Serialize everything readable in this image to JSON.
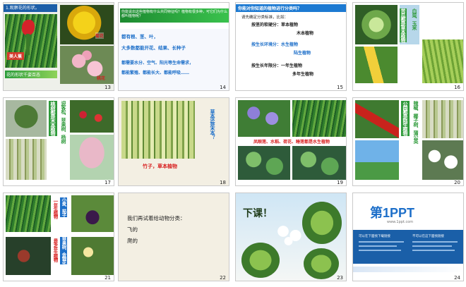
{
  "slides": [
    {
      "num": "13",
      "title_bar": "1.观察花的形状。",
      "labels": {
        "flower1": "美人蕉",
        "flower2": "菊花",
        "flower3": "桃花"
      },
      "caption": "花的形状千姿百态"
    },
    {
      "num": "14",
      "top_text": "你能说出这些植物有什么共同特征吗？植物有很多种，可它们为什么都叫植物呢？",
      "lines": [
        "都有根、茎、叶，",
        "大多数都能开花、结果、长种子",
        "都需要水分、空气、阳光等生命需求，",
        "都能繁殖、都能长大、都能呼吸……"
      ]
    },
    {
      "num": "15",
      "top_text": "你能对你知道的植物进行分类吗？",
      "lines": [
        "请先确定分类标准，比如：",
        "按茎的软硬分：草本植物",
        "木本植物",
        "按生长环境分：水生植物",
        "陆生植物",
        "按生长年限分：一年生植物",
        "多年生植物"
      ]
    },
    {
      "num": "16",
      "labels": {
        "v1": "苦瓜都是草本植物",
        "v2": "白菜、玉米"
      }
    },
    {
      "num": "17",
      "labels": {
        "v1": "桃树都是木本植物",
        "v2": "迎客松、苹果树、杨树"
      }
    },
    {
      "num": "18",
      "question": "草本还是木本？",
      "answer": "竹子，草本植物"
    },
    {
      "num": "19",
      "caption": "凤眼莲、水稻、荷花、睡莲都是水生植物"
    },
    {
      "num": "20",
      "labels": {
        "v1": "公园都是陆生植物",
        "v2": "辣椒、椰子树、蒲公英"
      }
    },
    {
      "num": "21",
      "labels": {
        "v1": "一年生植物",
        "v2": "小麦、茄子",
        "v3": "是多年生植物",
        "v4": "苹果树、金银花"
      }
    },
    {
      "num": "22",
      "lines": [
        "我们再试着给动物分类：",
        "飞的",
        "爬的"
      ]
    },
    {
      "num": "23",
      "big_text": "下课！"
    },
    {
      "num": "24",
      "brand": "第1PPT",
      "brand_sub": "www.1ppt.com",
      "menu_left": "可以在下面找下载链接",
      "menu_right": "不可以在这下面找链接"
    }
  ],
  "colors": {
    "accent_blue": "#1d6fc9",
    "title_red": "#d82020",
    "caption_green": "#2e8b2e"
  }
}
